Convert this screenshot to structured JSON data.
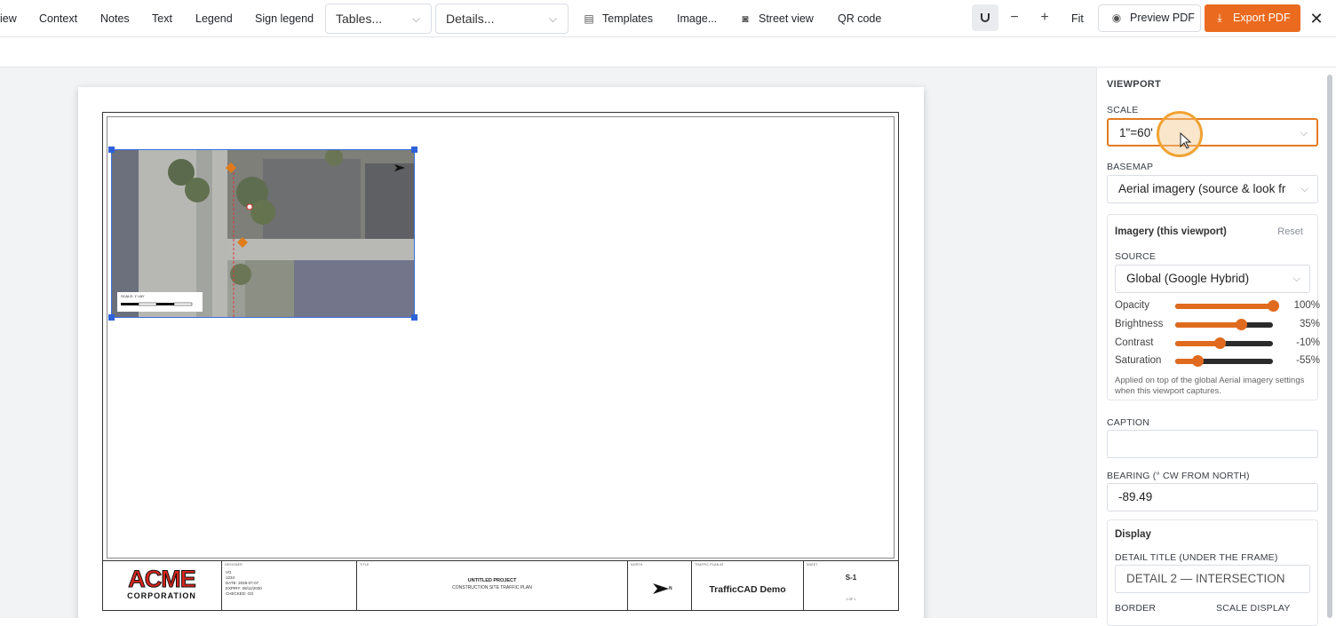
{
  "toolbar": {
    "items": [
      "iew",
      "Context",
      "Notes",
      "Text",
      "Legend",
      "Sign legend"
    ],
    "tables_select": "Tables...",
    "details_select": "Details...",
    "templates": "Templates",
    "image": "Image...",
    "street_view": "Street view",
    "qr_code": "QR code",
    "zoom_out": "−",
    "zoom_in": "+",
    "fit": "Fit",
    "preview_pdf": "Preview PDF",
    "export_pdf": "Export PDF",
    "close": "✕"
  },
  "sheet": {
    "scale_text": "SCALE: 1\"=60'",
    "title_block": {
      "logo_top": "ACME",
      "logo_bottom": "CORPORATION",
      "designer_label": "DESIGNER",
      "designer_lines": [
        "VG",
        "1234",
        "DATE: 2026-07-07",
        "EXPIRY: 08/11/2030",
        "CHECKED: GG"
      ],
      "title_label": "TITLE",
      "project_title": "UNTITLED PROJECT",
      "project_subtitle": "CONSTRUCTION SITE TRAFFIC PLAN",
      "north_label": "NORTH",
      "north_letter": "N",
      "plan_label": "TRAFFIC PLAN AT",
      "plan_name": "TrafficCAD Demo",
      "sheet_label": "SHEET",
      "sheet_number": "S-1",
      "sheet_of": "1 OF 1"
    }
  },
  "panel": {
    "section": "VIEWPORT",
    "scale_label": "SCALE",
    "scale_value": "1\"=60'",
    "basemap_label": "BASEMAP",
    "basemap_value": "Aerial imagery (source & look fr",
    "imagery": {
      "title": "Imagery (this viewport)",
      "reset": "Reset",
      "source_label": "SOURCE",
      "source_value": "Global (Google Hybrid)",
      "sliders": [
        {
          "label": "Opacity",
          "value": "100%",
          "level": 1.0
        },
        {
          "label": "Brightness",
          "value": "35%",
          "level": 0.675
        },
        {
          "label": "Contrast",
          "value": "-10%",
          "level": 0.45
        },
        {
          "label": "Saturation",
          "value": "-55%",
          "level": 0.225
        }
      ],
      "note": "Applied on top of the global Aerial imagery settings when this viewport captures."
    },
    "caption_label": "CAPTION",
    "caption_value": "",
    "bearing_label": "BEARING (° CW FROM NORTH)",
    "bearing_value": "-89.49",
    "display": {
      "title": "Display",
      "detail_title_label": "DETAIL TITLE (UNDER THE FRAME)",
      "detail_title_value": "DETAIL 2 — INTERSECTION",
      "border_label": "BORDER",
      "scale_display_label": "SCALE DISPLAY"
    }
  },
  "colors": {
    "accent": "#ea6a1f",
    "selection": "#2f62d9"
  }
}
